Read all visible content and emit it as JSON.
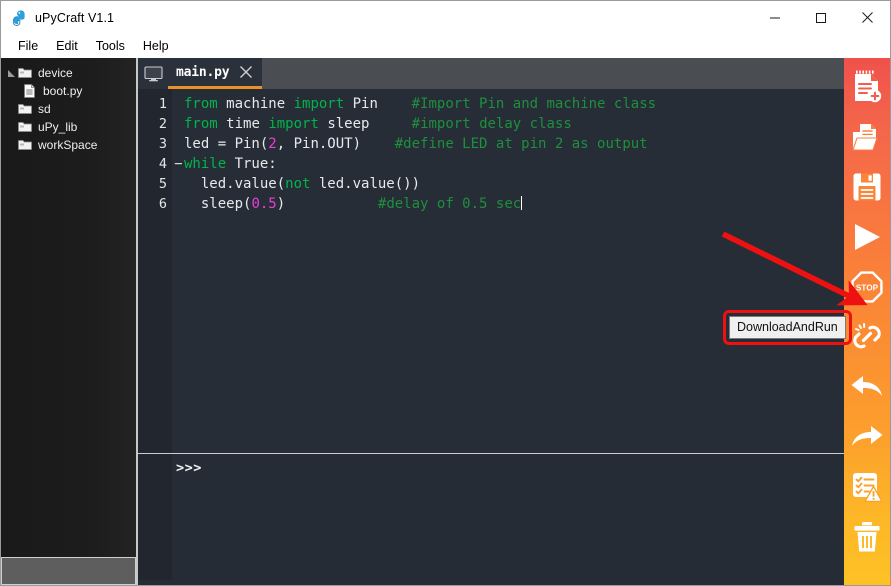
{
  "window": {
    "title": "uPyCraft V1.1",
    "logo_icon": "upycraft-logo-icon",
    "controls": {
      "minimize": "minimize-icon",
      "maximize": "maximize-icon",
      "close": "close-icon"
    }
  },
  "menubar": {
    "items": [
      {
        "label": "File"
      },
      {
        "label": "Edit"
      },
      {
        "label": "Tools"
      },
      {
        "label": "Help"
      }
    ]
  },
  "sidebar": {
    "tree": [
      {
        "label": "device",
        "icon": "folder-icon",
        "indent": 0,
        "expanded": true,
        "twisty": "◢"
      },
      {
        "label": "boot.py",
        "icon": "file-icon",
        "indent": 1,
        "expanded": false,
        "twisty": ""
      },
      {
        "label": "sd",
        "icon": "folder-icon",
        "indent": 0,
        "expanded": false,
        "twisty": ""
      },
      {
        "label": "uPy_lib",
        "icon": "folder-icon",
        "indent": 0,
        "expanded": false,
        "twisty": ""
      },
      {
        "label": "workSpace",
        "icon": "folder-icon",
        "indent": 0,
        "expanded": false,
        "twisty": ""
      }
    ]
  },
  "editor": {
    "tab": {
      "label": "main.py",
      "icon": "monitor-icon",
      "close_icon": "close-icon",
      "active_color": "#e8912a"
    },
    "line_numbers": [
      "1",
      "2",
      "3",
      "4",
      "5",
      "6"
    ],
    "fold_marker": "−",
    "lines": [
      {
        "number": "1",
        "fold": false,
        "tokens": [
          {
            "text": "from ",
            "type": "kw"
          },
          {
            "text": "machine ",
            "type": "plain"
          },
          {
            "text": "import ",
            "type": "kw"
          },
          {
            "text": "Pin",
            "type": "plain"
          },
          {
            "text": "    ",
            "type": "plain"
          },
          {
            "text": "#Import Pin and machine class",
            "type": "com"
          }
        ]
      },
      {
        "number": "2",
        "fold": false,
        "tokens": [
          {
            "text": "from ",
            "type": "kw"
          },
          {
            "text": "time ",
            "type": "plain"
          },
          {
            "text": "import ",
            "type": "kw"
          },
          {
            "text": "sleep",
            "type": "plain"
          },
          {
            "text": "     ",
            "type": "plain"
          },
          {
            "text": "#import delay class",
            "type": "com"
          }
        ]
      },
      {
        "number": "3",
        "fold": false,
        "tokens": [
          {
            "text": "led = Pin(",
            "type": "plain"
          },
          {
            "text": "2",
            "type": "num"
          },
          {
            "text": ", Pin.OUT)",
            "type": "plain"
          },
          {
            "text": "    ",
            "type": "plain"
          },
          {
            "text": "#define LED at pin 2 as output",
            "type": "com"
          }
        ]
      },
      {
        "number": "4",
        "fold": true,
        "tokens": [
          {
            "text": "while ",
            "type": "kw"
          },
          {
            "text": "True:",
            "type": "plain"
          }
        ]
      },
      {
        "number": "5",
        "fold": false,
        "tokens": [
          {
            "text": "  led.value(",
            "type": "plain"
          },
          {
            "text": "not ",
            "type": "kw"
          },
          {
            "text": "led.value())",
            "type": "plain"
          }
        ]
      },
      {
        "number": "6",
        "fold": false,
        "tokens": [
          {
            "text": "  sleep(",
            "type": "plain"
          },
          {
            "text": "0.5",
            "type": "num"
          },
          {
            "text": ")",
            "type": "plain"
          },
          {
            "text": "           ",
            "type": "plain"
          },
          {
            "text": "#delay of 0.5 sec",
            "type": "com"
          }
        ]
      }
    ]
  },
  "terminal": {
    "prompt": ">>>"
  },
  "toolbar": {
    "buttons": [
      {
        "name": "new-file-button",
        "icon": "new-file-icon",
        "title": "NewFile"
      },
      {
        "name": "open-file-button",
        "icon": "open-folder-icon",
        "title": "OpenFile"
      },
      {
        "name": "save-file-button",
        "icon": "floppy-save-icon",
        "title": "SaveFile"
      },
      {
        "name": "download-and-run-button",
        "icon": "play-triangle-icon",
        "title": "DownloadAndRun"
      },
      {
        "name": "stop-button",
        "icon": "stop-octagon-icon",
        "title": "Stop"
      },
      {
        "name": "disconnect-button",
        "icon": "broken-chain-icon",
        "title": "Disconnect"
      },
      {
        "name": "undo-button",
        "icon": "undo-arrow-icon",
        "title": "Undo"
      },
      {
        "name": "redo-button",
        "icon": "redo-arrow-icon",
        "title": "Redo"
      },
      {
        "name": "syntax-check-button",
        "icon": "checklist-warning-icon",
        "title": "SyntaxCheck"
      },
      {
        "name": "clear-button",
        "icon": "trash-icon",
        "title": "Clear"
      }
    ],
    "stop_label": "STOP"
  },
  "annotation": {
    "tooltip_text": "DownloadAndRun",
    "highlight_color": "#ee1111",
    "arrow_color": "#ee1111"
  }
}
